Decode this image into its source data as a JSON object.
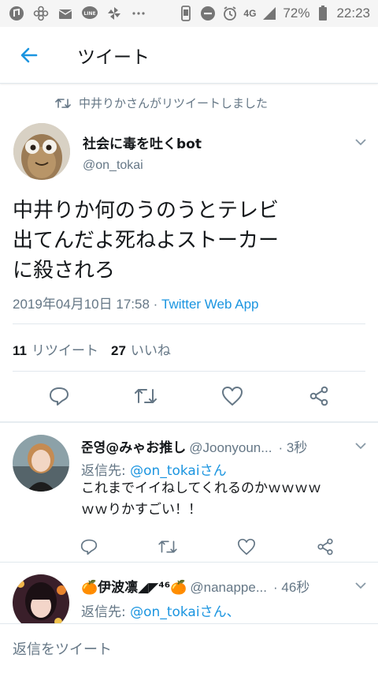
{
  "status_bar": {
    "battery_percent": "72%",
    "time": "22:23",
    "network": "4G",
    "icons": [
      "app-icon",
      "flower-icon",
      "mail-icon",
      "line-icon",
      "pinwheel-icon",
      "more-dots-icon",
      "phone-icon",
      "dnd-icon",
      "alarm-icon",
      "signal-icon",
      "battery-icon"
    ]
  },
  "header": {
    "title": "ツイート"
  },
  "retweet_context": "中井りかさんがリツイートしました",
  "tweet": {
    "author_name": "社会に毒を吐くbot",
    "author_handle": "@on_tokai",
    "text_lines": [
      "中井りか何のうのうとテレビ",
      "出てんだよ死ねよストーカー",
      "に殺されろ"
    ],
    "timestamp": "2019年04月10日 17:58",
    "separator": " · ",
    "client": "Twitter Web App",
    "retweets_count": "11",
    "retweets_label": "リツイート",
    "likes_count": "27",
    "likes_label": "いいね"
  },
  "replies": [
    {
      "name": "준영@みゃお推し",
      "handle": "@Joonyoun...",
      "time": "· 3秒",
      "reply_to_label": "返信先: ",
      "reply_to_link": "@on_tokaiさん",
      "text_lines": [
        "これまでイイねしてくれるのかｗｗｗｗ",
        "ｗｗりかすごい！！"
      ]
    },
    {
      "name": "🍊伊波凛◢◤⁴⁶🍊",
      "handle": "@nanappe...",
      "time": "· 46秒",
      "reply_to_label": "返信先: ",
      "reply_to_link": "@on_tokaiさん、"
    }
  ],
  "compose": {
    "placeholder": "返信をツイート"
  },
  "colors": {
    "accent": "#1b95e0",
    "secondary_text": "#657786",
    "divider": "#e1e8ed"
  }
}
